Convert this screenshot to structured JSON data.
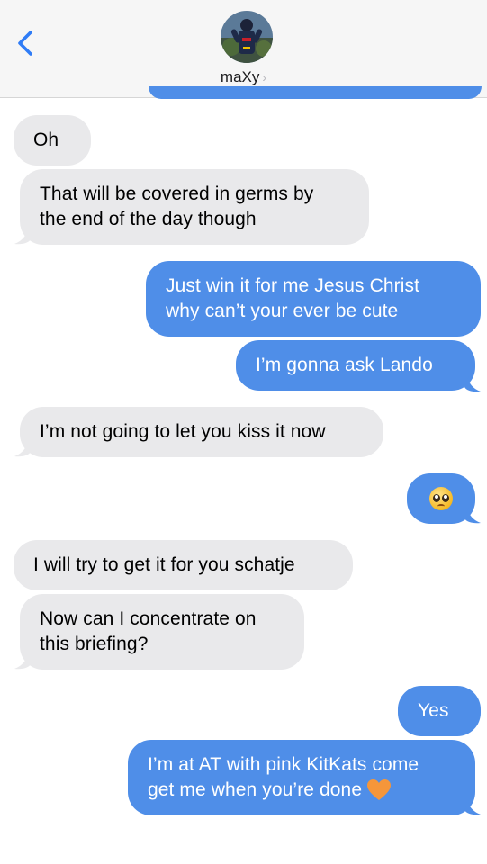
{
  "header": {
    "contact_name": "maXy",
    "chevron": "›"
  },
  "colors": {
    "sent_bubble": "#4f8ee8",
    "received_bubble": "#e9e9eb",
    "accent": "#2f7cf6"
  },
  "messages": [
    {
      "direction": "received",
      "text": "Oh"
    },
    {
      "direction": "received",
      "line1": "That will be covered in germs by",
      "line2": "the end of the day though"
    },
    {
      "direction": "sent",
      "line1": "Just win it for me Jesus Christ",
      "line2": "why can’t your ever be cute"
    },
    {
      "direction": "sent",
      "text": "I’m gonna ask Lando"
    },
    {
      "direction": "received",
      "text": "I’m not going to let you kiss it now"
    },
    {
      "direction": "sent",
      "emoji": "pleading-face-emoji"
    },
    {
      "direction": "received",
      "text": "I will try to get it for you schatje"
    },
    {
      "direction": "received",
      "line1": "Now can I concentrate on",
      "line2": "this briefing?"
    },
    {
      "direction": "sent",
      "text": "Yes"
    },
    {
      "direction": "sent",
      "line1": "I’m at AT with pink KitKats come",
      "line2": "get me when you’re done",
      "emoji": "orange-heart-emoji"
    }
  ]
}
